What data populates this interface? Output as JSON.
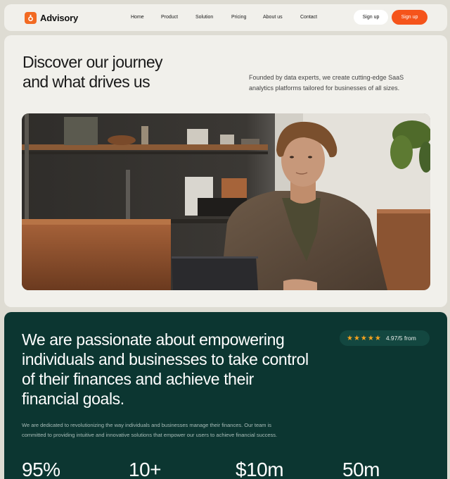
{
  "header": {
    "brand": "Advisory",
    "nav": [
      "Home",
      "Product",
      "Solution",
      "Pricing",
      "About us",
      "Contact"
    ],
    "signin_label": "Sign up",
    "signup_label": "Sign up"
  },
  "hero": {
    "title_line1": "Discover our journey",
    "title_line2": "and what drives us",
    "subtitle_line1": "Founded by data experts, we create cutting-edge SaaS",
    "subtitle_line2": "analytics platforms tailored for businesses of all sizes."
  },
  "mission": {
    "title": [
      "We are passionate about empowering",
      "individuals and businesses to take control",
      "of their finances and achieve their",
      "financial goals."
    ],
    "body": [
      "We are dedicated to revolutionizing the way individuals and businesses manage their finances. Our team is",
      "committed to providing intuitive and innovative solutions that empower our users to achieve financial success."
    ],
    "rating": {
      "stars": 5,
      "text": "4.97/5 from"
    },
    "stats": [
      "95%",
      "10+",
      "$10m",
      "50m"
    ]
  },
  "colors": {
    "accent": "#f5541b",
    "mission_bg": "#0c3631",
    "page_bg": "#dedcd3",
    "card_bg": "#f1f0eb",
    "star": "#f4a21e"
  },
  "icons": [
    "logo-icon",
    "star-icon"
  ]
}
